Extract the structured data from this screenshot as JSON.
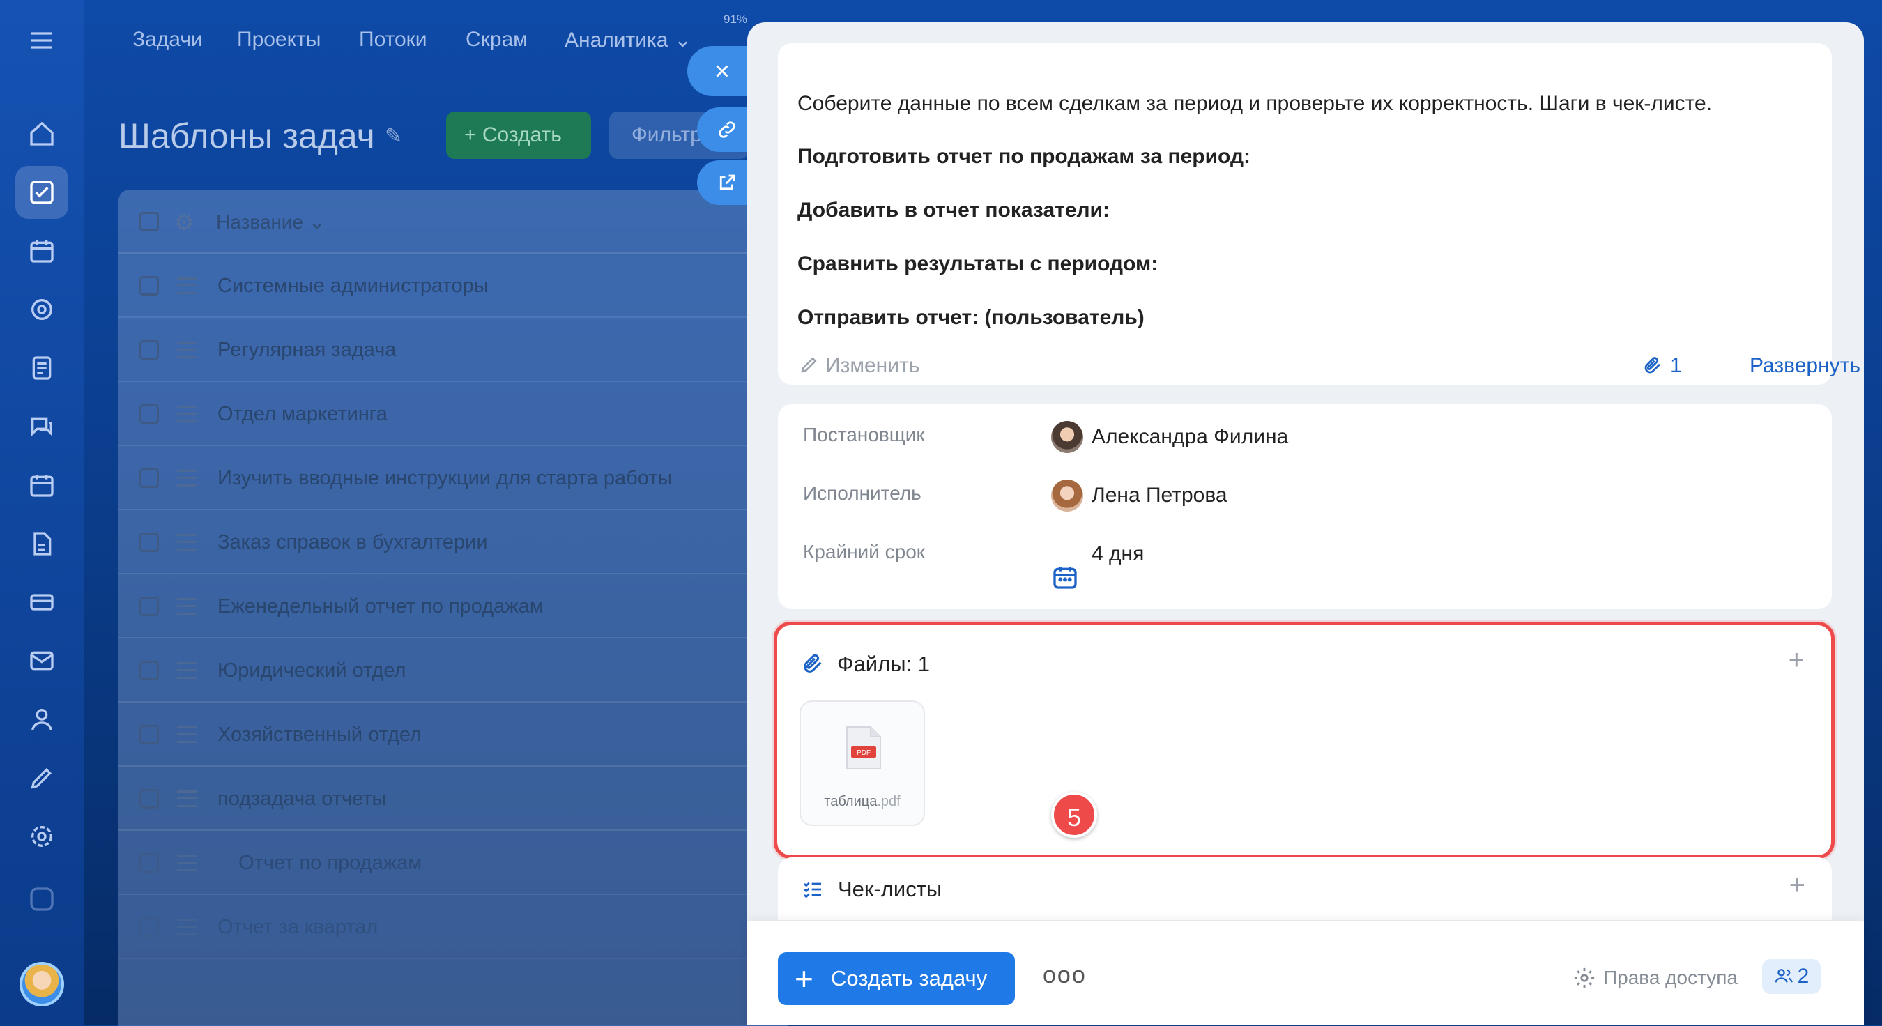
{
  "background": {
    "nav": [
      "Задачи",
      "Проекты",
      "Потоки",
      "Скрам",
      "Аналитика"
    ],
    "nav_percent": "91%",
    "page_title": "Шаблоны задач",
    "create_label": "+ Создать",
    "filter_label": "Фильтр",
    "column_name": "Название",
    "rows": [
      "Системные администраторы",
      "Регулярная задача",
      "Отдел маркетинга",
      "Изучить вводные инструкции для старта работы",
      "Заказ справок в бухгалтерии",
      "Еженедельный отчет по продажам",
      "Юридический отдел",
      "Хозяйственный отдел",
      "подзадача отчеты",
      "Отчет по продажам",
      "Отчет за квартал"
    ]
  },
  "description": {
    "lines": [
      "Соберите данные по всем сделкам за период и проверьте их корректность. Шаги в чек-листе.",
      "Подготовить отчет по продажам за период:",
      "Добавить в отчет показатели:",
      "Сравнить результаты с периодом:",
      "Отправить отчет: (пользователь)"
    ],
    "edit_label": "Изменить",
    "attachments_count": "1",
    "expand_label": "Развернуть"
  },
  "people": {
    "creator_label": "Постановщик",
    "creator_name": "Александра Филина",
    "assignee_label": "Исполнитель",
    "assignee_name": "Лена Петрова",
    "deadline_label": "Крайний срок",
    "deadline_value": "4 дня"
  },
  "files": {
    "title": "Файлы: 1",
    "file_base": "таблица",
    "file_ext": ".pdf",
    "file_type": "PDF",
    "badge": "5"
  },
  "checklists": {
    "title": "Чек-листы"
  },
  "footer": {
    "create_task": "Создать задачу",
    "more": "ooo",
    "access_rights": "Права доступа",
    "members_count": "2"
  },
  "colors": {
    "accent": "#1f7ae8",
    "link": "#1d63c7",
    "highlight": "#ef4a4a"
  }
}
